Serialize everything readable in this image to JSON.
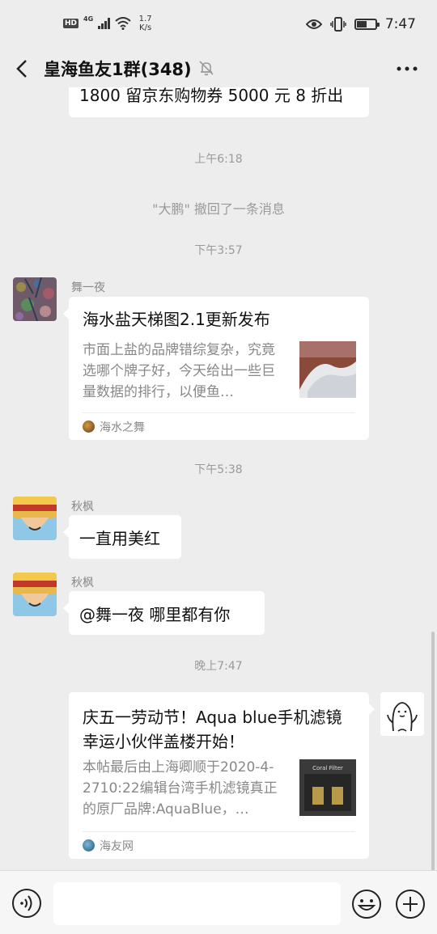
{
  "status_bar": {
    "hd": "HD",
    "network": "4G",
    "speed_value": "1.7",
    "speed_unit": "K/s",
    "time": "7:47"
  },
  "header": {
    "title": "皇海鱼友1群(348)"
  },
  "messages": {
    "partial_bubble_text": "1800 留京东购物券 5000 元 8 折出",
    "ts1": "上午6:18",
    "recall_notice": "\"大鹏\" 撤回了一条消息",
    "ts2": "下午3:57",
    "msg1": {
      "sender": "舞一夜",
      "link_title": "海水盐天梯图2.1更新发布",
      "link_desc": "市面上盐的品牌错综复杂，究竟选哪个牌子好，今天给出一些巨量数据的排行，以便鱼…",
      "source": "海水之舞"
    },
    "ts3": "下午5:38",
    "msg2": {
      "sender": "秋枫",
      "text": "一直用美红"
    },
    "msg3": {
      "sender": "秋枫",
      "text": "@舞一夜  哪里都有你"
    },
    "ts4": "晚上7:47",
    "msg4": {
      "link_title": "庆五一劳动节！Aqua blue手机滤镜幸运小伙伴盖楼开始！",
      "link_desc": "本帖最后由上海卿顺于2020-4-2710:22编辑台湾手机滤镜真正的原厂品牌:AquaBlue，…",
      "thumb_text": "Coral Filter",
      "source": "海友网"
    }
  },
  "input_bar": {
    "placeholder": ""
  },
  "colors": {
    "background": "#ededed",
    "bubble": "#ffffff",
    "muted_text": "#9a9a9a"
  }
}
